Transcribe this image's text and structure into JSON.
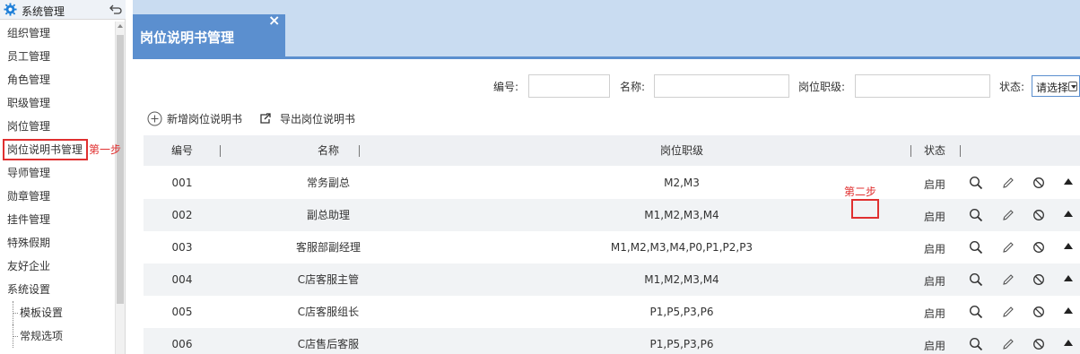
{
  "sidebar": {
    "title": "系统管理",
    "items": [
      {
        "label": "组织管理"
      },
      {
        "label": "员工管理"
      },
      {
        "label": "角色管理"
      },
      {
        "label": "职级管理"
      },
      {
        "label": "岗位管理"
      },
      {
        "label": "岗位说明书管理",
        "active": true
      },
      {
        "label": "导师管理"
      },
      {
        "label": "勋章管理"
      },
      {
        "label": "挂件管理"
      },
      {
        "label": "特殊假期"
      },
      {
        "label": "友好企业"
      },
      {
        "label": "系统设置"
      },
      {
        "label": "模板设置",
        "sub": true
      },
      {
        "label": "常规选项",
        "sub": true
      }
    ],
    "step1_annotation": "第一步"
  },
  "tab": {
    "title": "岗位说明书管理",
    "close": "×"
  },
  "filters": {
    "code_label": "编号:",
    "name_label": "名称:",
    "level_label": "岗位职级:",
    "status_label": "状态:",
    "status_value": "请选择"
  },
  "toolbar": {
    "add_label": "新增岗位说明书",
    "export_label": "导出岗位说明书"
  },
  "table": {
    "columns": [
      "编号",
      "名称",
      "岗位职级",
      "状态"
    ],
    "rows": [
      {
        "code": "001",
        "name": "常务副总",
        "level": "M2,M3",
        "status": "启用"
      },
      {
        "code": "002",
        "name": "副总助理",
        "level": "M1,M2,M3,M4",
        "status": "启用"
      },
      {
        "code": "003",
        "name": "客服部副经理",
        "level": "M1,M2,M3,M4,P0,P1,P2,P3",
        "status": "启用"
      },
      {
        "code": "004",
        "name": "C店客服主管",
        "level": "M1,M2,M3,M4",
        "status": "启用"
      },
      {
        "code": "005",
        "name": "C店客服组长",
        "level": "P1,P5,P3,P6",
        "status": "启用"
      },
      {
        "code": "006",
        "name": "C店售后客服",
        "level": "P1,P5,P3,P6",
        "status": "启用"
      }
    ],
    "step2_annotation": "第二步"
  },
  "colors": {
    "accent": "#5b8fcf",
    "banner": "#c9dcf1",
    "annotation": "#e03030",
    "gear": "#1e7fd8"
  },
  "icons": [
    "gear-icon",
    "back-arrow-icon",
    "close-icon",
    "add-circle-icon",
    "export-icon",
    "search-icon",
    "edit-icon",
    "ban-icon",
    "move-up-icon"
  ]
}
